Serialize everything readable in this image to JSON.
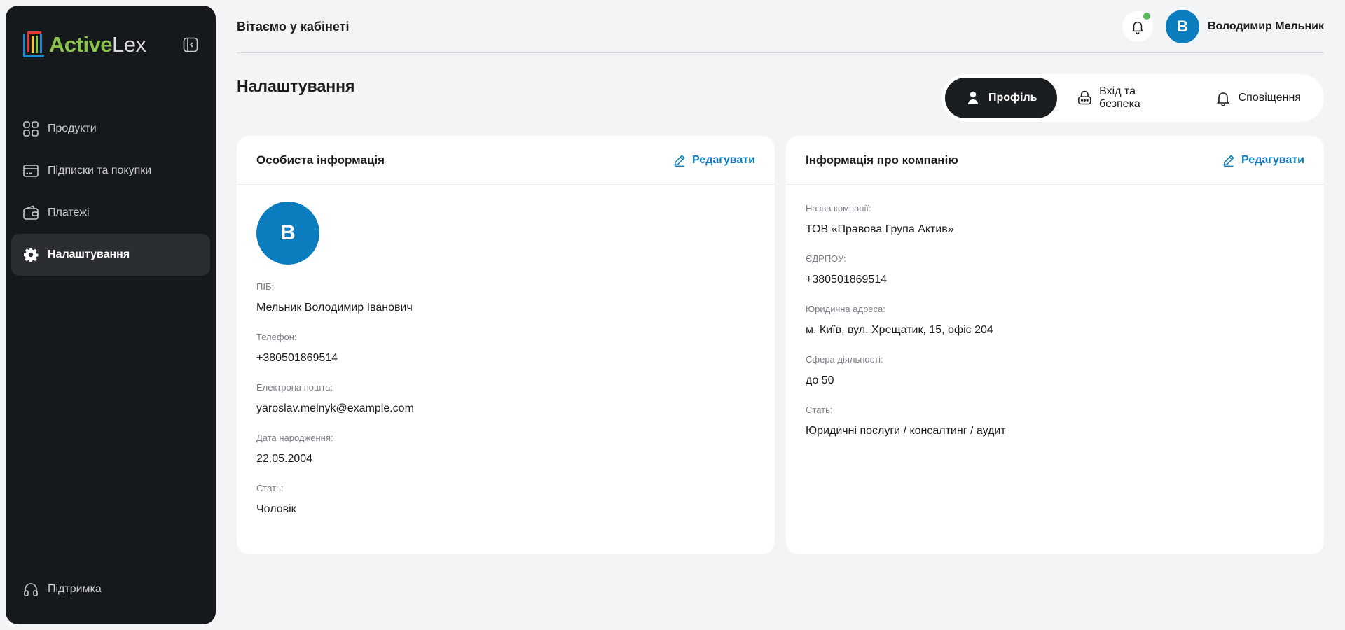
{
  "brand": {
    "name_part1": "Active",
    "name_part2": "Lex",
    "accent": "#8bc34a"
  },
  "sidebar": {
    "items": [
      {
        "label": "Продукти",
        "icon": "grid-icon"
      },
      {
        "label": "Підписки та покупки",
        "icon": "card-icon"
      },
      {
        "label": "Платежі",
        "icon": "wallet-icon"
      },
      {
        "label": "Налаштування",
        "icon": "gear-icon",
        "active": true
      }
    ],
    "support_label": "Підтримка"
  },
  "header": {
    "welcome": "Вітаємо у кабінеті",
    "user_initial": "В",
    "user_name": "Володимир Мельник"
  },
  "page": {
    "title": "Налаштування",
    "tabs": [
      {
        "label": "Профіль",
        "icon": "user-icon",
        "active": true
      },
      {
        "label": "Вхід та безпека",
        "icon": "lock-icon"
      },
      {
        "label": "Сповіщення",
        "icon": "bell-icon"
      }
    ]
  },
  "personal": {
    "title": "Особиста інформація",
    "edit_label": "Редагувати",
    "avatar_initial": "В",
    "fields": [
      {
        "label": "ПІБ:",
        "value": "Мельник Володимир Іванович"
      },
      {
        "label": "Телефон:",
        "value": "+380501869514"
      },
      {
        "label": "Електрона пошта:",
        "value": "yaroslav.melnyk@example.com"
      },
      {
        "label": "Дата народження:",
        "value": "22.05.2004"
      },
      {
        "label": "Стать:",
        "value": "Чоловік"
      }
    ]
  },
  "company": {
    "title": "Інформація про компанію",
    "edit_label": "Редагувати",
    "fields": [
      {
        "label": "Назва компанії:",
        "value": "ТОВ «Правова Група Актив»"
      },
      {
        "label": "ЄДРПОУ:",
        "value": "+380501869514"
      },
      {
        "label": "Юридична адреса:",
        "value": "м. Київ, вул. Хрещатик, 15, офіс 204"
      },
      {
        "label": "Сфера діяльності:",
        "value": "до 50"
      },
      {
        "label": "Стать:",
        "value": "Юридичні послуги / консалтинг / аудит"
      }
    ]
  },
  "colors": {
    "primary": "#0b7dbf",
    "sidebar_bg": "#16191c",
    "notification_dot": "#5cb85c"
  }
}
